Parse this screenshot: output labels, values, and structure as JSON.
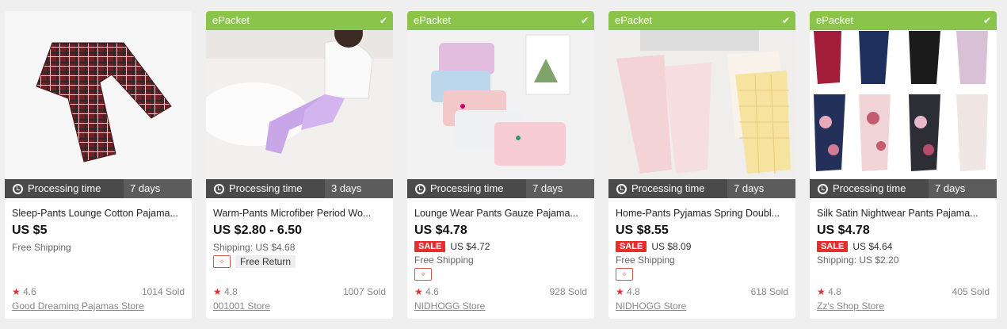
{
  "products": [
    {
      "epacket": "",
      "processing_label": "Processing time",
      "processing_days": "7 days",
      "title": "Sleep-Pants Lounge Cotton Pajama...",
      "price": "US $5",
      "sale_badge": "",
      "sale_price": "",
      "shipping": "Free Shipping",
      "free_return": "",
      "rating": "4.6",
      "sold": "1014 Sold",
      "store": "Good Dreaming Pajamas Store"
    },
    {
      "epacket": "ePacket",
      "processing_label": "Processing time",
      "processing_days": "3 days",
      "title": "Warm-Pants Microfiber Period Wo...",
      "price": "US $2.80 - 6.50",
      "sale_badge": "",
      "sale_price": "",
      "shipping": "Shipping: US $4.68",
      "free_return": "Free Return",
      "rating": "4.8",
      "sold": "1007 Sold",
      "store": "001001 Store"
    },
    {
      "epacket": "ePacket",
      "processing_label": "Processing time",
      "processing_days": "7 days",
      "title": "Lounge Wear Pants Gauze Pajama...",
      "price": "US $4.78",
      "sale_badge": "SALE",
      "sale_price": "US $4.72",
      "shipping": "Free Shipping",
      "free_return": "",
      "rating": "4.6",
      "sold": "928 Sold",
      "store": "NIDHOGG Store"
    },
    {
      "epacket": "ePacket",
      "processing_label": "Processing time",
      "processing_days": "7 days",
      "title": "Home-Pants Pyjamas Spring Doubl...",
      "price": "US $8.55",
      "sale_badge": "SALE",
      "sale_price": "US $8.09",
      "shipping": "Free Shipping",
      "free_return": "",
      "rating": "4.8",
      "sold": "618 Sold",
      "store": "NIDHOGG Store"
    },
    {
      "epacket": "ePacket",
      "processing_label": "Processing time",
      "processing_days": "7 days",
      "title": "Silk Satin Nightwear Pants Pajama...",
      "price": "US $4.78",
      "sale_badge": "SALE",
      "sale_price": "US $4.64",
      "shipping": "Shipping: US $2.20",
      "free_return": "",
      "rating": "4.8",
      "sold": "405 Sold",
      "store": "Zz's Shop Store"
    }
  ],
  "colors": {
    "epacket_green": "#8ac44a",
    "sale_red": "#e62e2e",
    "processing_bar": "#4a4a4a"
  }
}
